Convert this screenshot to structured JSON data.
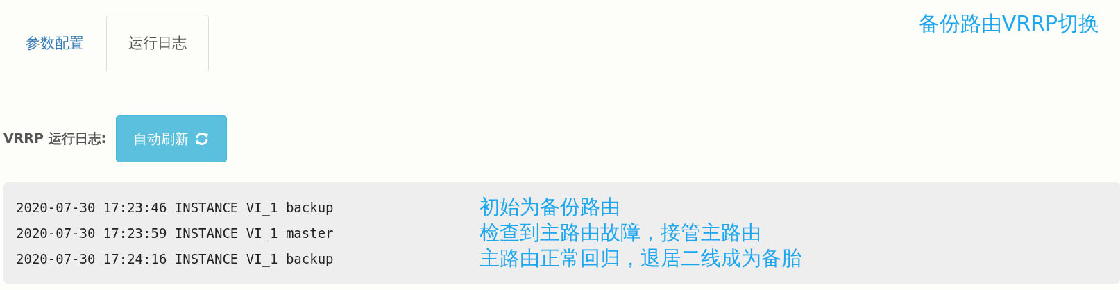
{
  "annotation_title": "备份路由VRRP切换",
  "tabs": [
    {
      "label": "参数配置",
      "selected": false
    },
    {
      "label": "运行日志",
      "selected": true
    }
  ],
  "log_section": {
    "label": "VRRP 运行日志:",
    "button": "自动刷新"
  },
  "log_lines": [
    {
      "text": "2020-07-30 17:23:46 INSTANCE VI_1 backup",
      "note": "初始为备份路由"
    },
    {
      "text": "2020-07-30 17:23:59 INSTANCE VI_1 master",
      "note": "检查到主路由故障，接管主路由"
    },
    {
      "text": "2020-07-30 17:24:16 INSTANCE VI_1 backup",
      "note": "主路由正常回归，退居二线成为备胎"
    }
  ]
}
